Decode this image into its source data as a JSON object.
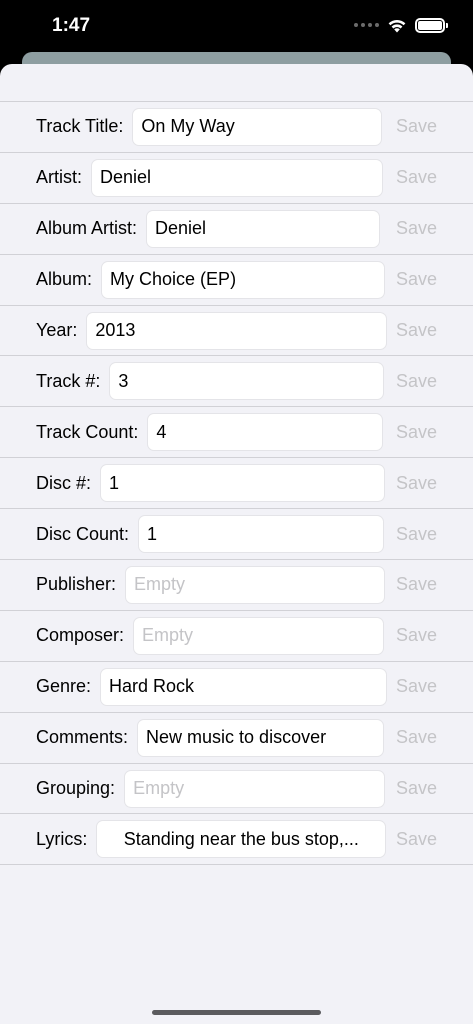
{
  "status": {
    "time": "1:47"
  },
  "fields": [
    {
      "label": "Track Title:",
      "value": "On My Way",
      "empty": false,
      "save": "Save"
    },
    {
      "label": "Artist:",
      "value": "Deniel",
      "empty": false,
      "save": "Save"
    },
    {
      "label": "Album Artist:",
      "value": "Deniel",
      "empty": false,
      "save": "Save"
    },
    {
      "label": "Album:",
      "value": "My Choice (EP)",
      "empty": false,
      "save": "Save"
    },
    {
      "label": "Year:",
      "value": "2013",
      "empty": false,
      "save": "Save"
    },
    {
      "label": "Track #:",
      "value": "3",
      "empty": false,
      "save": "Save"
    },
    {
      "label": "Track Count:",
      "value": "4",
      "empty": false,
      "save": "Save"
    },
    {
      "label": "Disc #:",
      "value": "1",
      "empty": false,
      "save": "Save"
    },
    {
      "label": "Disc Count:",
      "value": "1",
      "empty": false,
      "save": "Save"
    },
    {
      "label": "Publisher:",
      "value": "Empty",
      "empty": true,
      "save": "Save"
    },
    {
      "label": "Composer:",
      "value": "Empty",
      "empty": true,
      "save": "Save"
    },
    {
      "label": "Genre:",
      "value": "Hard Rock",
      "empty": false,
      "save": "Save"
    },
    {
      "label": "Comments:",
      "value": "New music to discover",
      "empty": false,
      "save": "Save"
    },
    {
      "label": "Grouping:",
      "value": "Empty",
      "empty": true,
      "save": "Save"
    },
    {
      "label": "Lyrics:",
      "value": "Standing near the bus stop,...",
      "empty": false,
      "save": "Save"
    }
  ]
}
